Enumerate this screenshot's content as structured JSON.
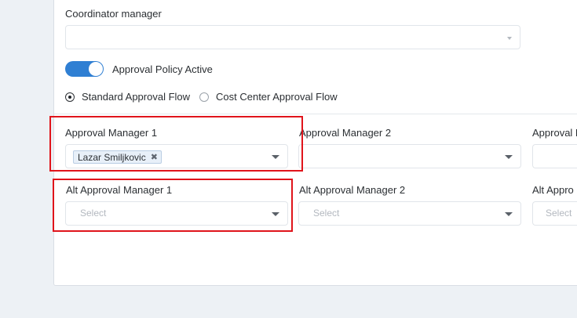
{
  "coordinator": {
    "label": "Coordinator manager",
    "value": ""
  },
  "approval_policy": {
    "label": "Approval Policy Active",
    "active": true
  },
  "flow": {
    "options": [
      "Standard Approval Flow",
      "Cost Center Approval Flow"
    ],
    "selected": "Standard Approval Flow"
  },
  "managers": [
    {
      "label": "Approval Manager 1",
      "chip": "Lazar Smiljkovic"
    },
    {
      "label": "Approval Manager 2"
    },
    {
      "label": "Approval M"
    }
  ],
  "alt_managers": [
    {
      "label": "Alt Approval Manager 1",
      "placeholder": "Select"
    },
    {
      "label": "Alt Approval Manager 2",
      "placeholder": "Select"
    },
    {
      "label": "Alt Appro",
      "placeholder": "Select"
    }
  ],
  "colors": {
    "accent": "#2f7fd3",
    "highlight": "#e0141b",
    "chip_bg": "#e8f0f9"
  },
  "icons": {
    "chip_remove": "close-icon",
    "dropdown": "caret-down-icon"
  }
}
